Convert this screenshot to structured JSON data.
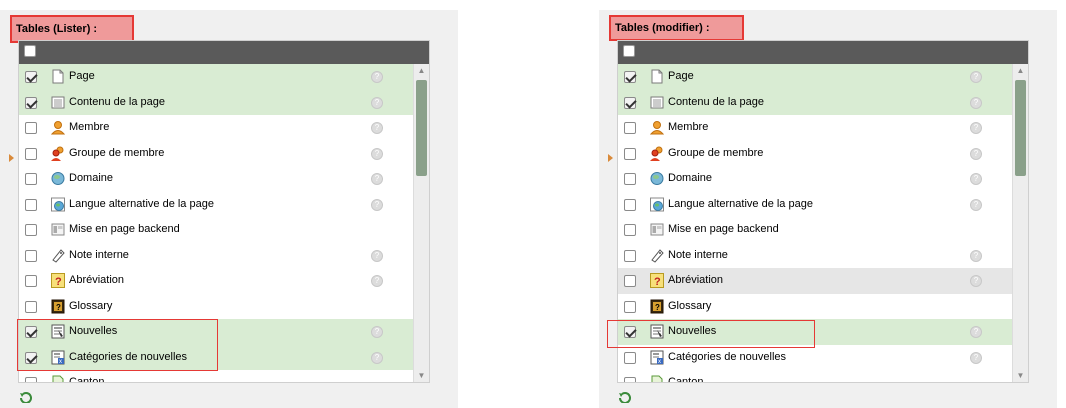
{
  "colors": {
    "highlight": "#e53935",
    "checked_row": "#d9ecd3",
    "header": "#5a5a5a"
  },
  "panels": [
    {
      "title": "Tables (Lister) :",
      "rows": [
        {
          "label": "Page",
          "icon": "page-icon",
          "checked": true,
          "help": true
        },
        {
          "label": "Contenu de la page",
          "icon": "content-icon",
          "checked": true,
          "help": true
        },
        {
          "label": "Membre",
          "icon": "member-icon",
          "checked": false,
          "help": true
        },
        {
          "label": "Groupe de membre",
          "icon": "member-group-icon",
          "checked": false,
          "help": true
        },
        {
          "label": "Domaine",
          "icon": "domain-icon",
          "checked": false,
          "help": true
        },
        {
          "label": "Langue alternative de la page",
          "icon": "language-icon",
          "checked": false,
          "help": true
        },
        {
          "label": "Mise en page backend",
          "icon": "layout-icon",
          "checked": false,
          "help": false
        },
        {
          "label": "Note interne",
          "icon": "note-icon",
          "checked": false,
          "help": true
        },
        {
          "label": "Abréviation",
          "icon": "abbreviation-icon",
          "checked": false,
          "help": true
        },
        {
          "label": "Glossary",
          "icon": "glossary-icon",
          "checked": false,
          "help": false
        },
        {
          "label": "Nouvelles",
          "icon": "news-icon",
          "checked": true,
          "help": true
        },
        {
          "label": "Catégories de nouvelles",
          "icon": "news-category-icon",
          "checked": true,
          "help": true
        },
        {
          "label": "Canton",
          "icon": "canton-icon",
          "checked": false,
          "help": false
        }
      ]
    },
    {
      "title": "Tables (modifier) :",
      "rows": [
        {
          "label": "Page",
          "icon": "page-icon",
          "checked": true,
          "help": true
        },
        {
          "label": "Contenu de la page",
          "icon": "content-icon",
          "checked": true,
          "help": true
        },
        {
          "label": "Membre",
          "icon": "member-icon",
          "checked": false,
          "help": true
        },
        {
          "label": "Groupe de membre",
          "icon": "member-group-icon",
          "checked": false,
          "help": true
        },
        {
          "label": "Domaine",
          "icon": "domain-icon",
          "checked": false,
          "help": true
        },
        {
          "label": "Langue alternative de la page",
          "icon": "language-icon",
          "checked": false,
          "help": true
        },
        {
          "label": "Mise en page backend",
          "icon": "layout-icon",
          "checked": false,
          "help": false
        },
        {
          "label": "Note interne",
          "icon": "note-icon",
          "checked": false,
          "help": true
        },
        {
          "label": "Abréviation",
          "icon": "abbreviation-icon",
          "checked": false,
          "help": true,
          "hover": true
        },
        {
          "label": "Glossary",
          "icon": "glossary-icon",
          "checked": false,
          "help": false
        },
        {
          "label": "Nouvelles",
          "icon": "news-icon",
          "checked": true,
          "help": true
        },
        {
          "label": "Catégories de nouvelles",
          "icon": "news-category-icon",
          "checked": false,
          "help": true
        },
        {
          "label": "Canton",
          "icon": "canton-icon",
          "checked": false,
          "help": false
        }
      ]
    }
  ]
}
